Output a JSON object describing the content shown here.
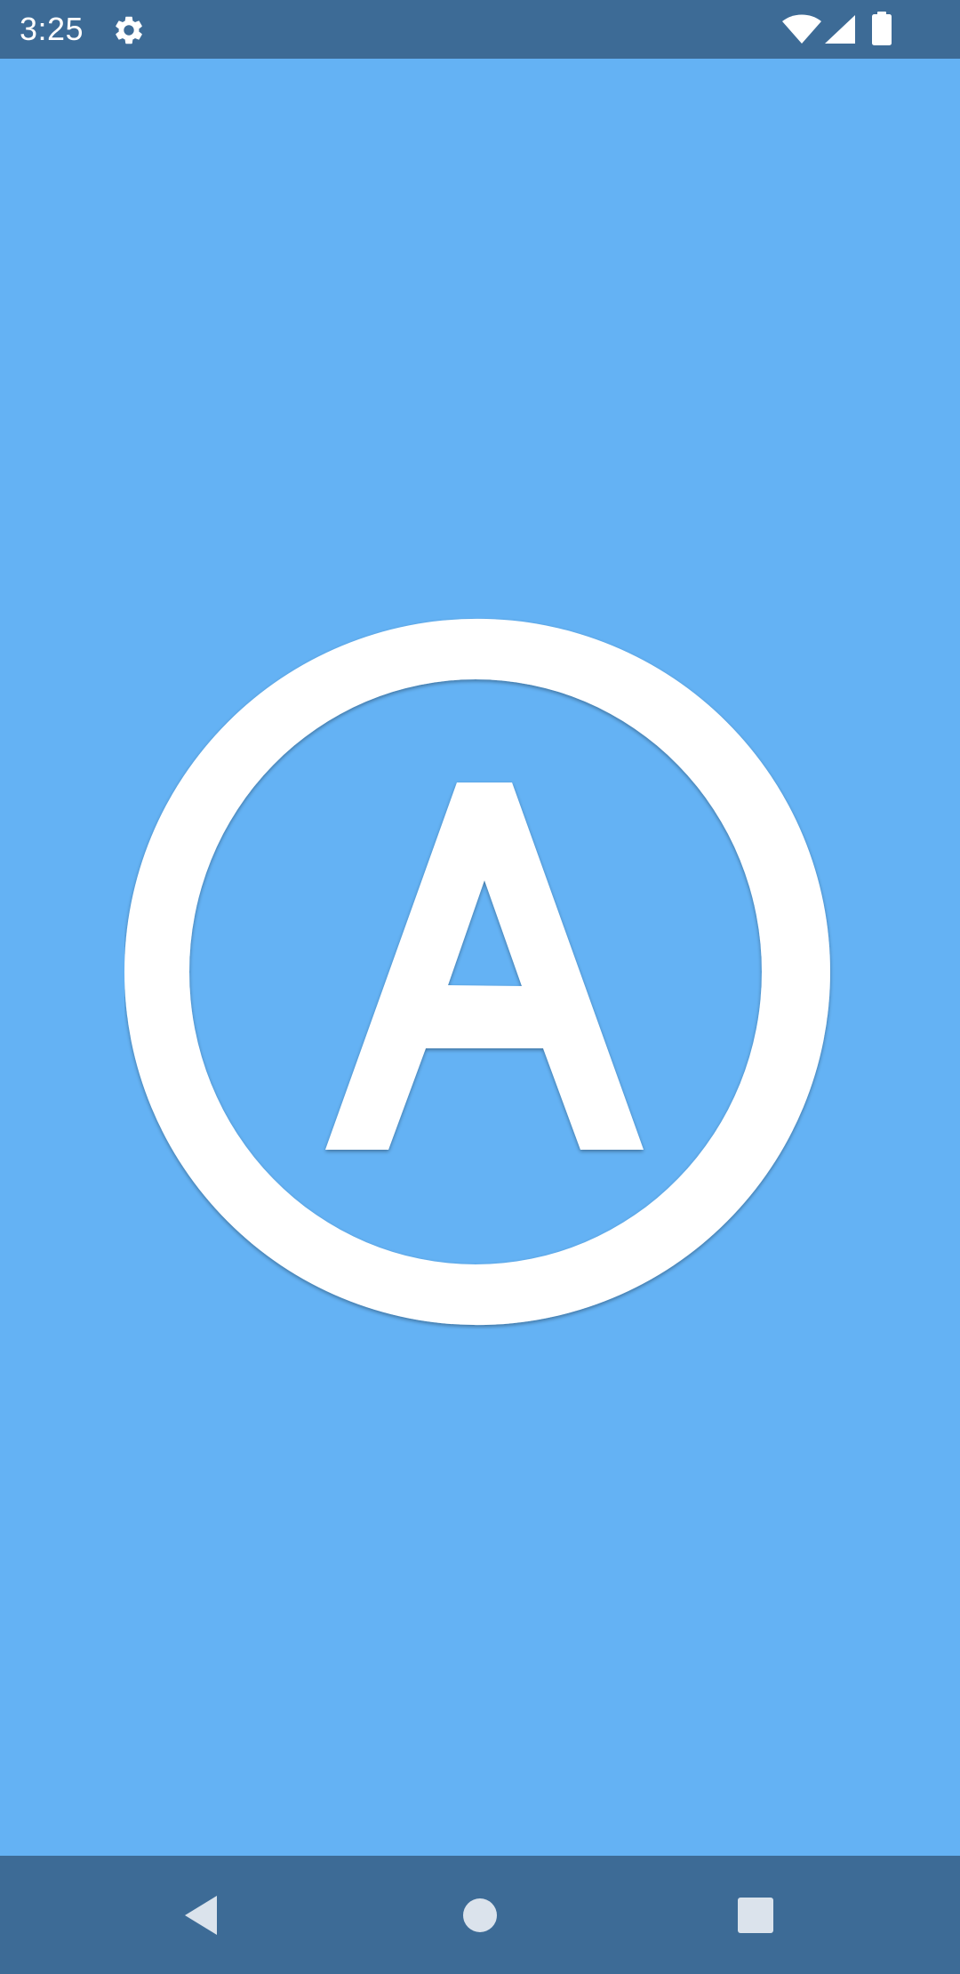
{
  "status_bar": {
    "time": "3:25",
    "icons": [
      "settings-icon",
      "wifi-icon",
      "cell-signal-icon",
      "battery-icon"
    ],
    "background": "#3d6b96"
  },
  "splash": {
    "logo_letter": "A",
    "logo_icon": "circled-a-logo",
    "background": "#64b2f4",
    "logo_color": "#ffffff"
  },
  "nav_bar": {
    "buttons": [
      "back-button",
      "home-button",
      "recents-button"
    ],
    "background": "#3d6b96",
    "button_color": "#dbe3ec"
  }
}
